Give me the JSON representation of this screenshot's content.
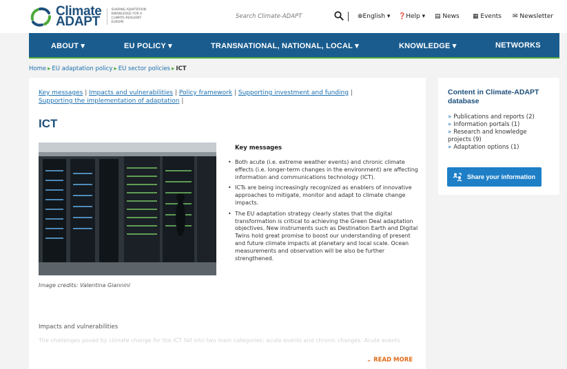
{
  "header": {
    "logo_line1": "Climate",
    "logo_line2": "ADAPT",
    "tagline": "Sharing adaptation knowledge for a climate-resilient Europe",
    "search_placeholder": "Search Climate-ADAPT",
    "language": "English",
    "help": "Help",
    "news": "News",
    "events": "Events",
    "newsletter": "Newsletter"
  },
  "nav": {
    "items": [
      "ABOUT",
      "EU POLICY",
      "TRANSNATIONAL, NATIONAL, LOCAL",
      "KNOWLEDGE",
      "NETWORKS"
    ]
  },
  "breadcrumb": {
    "home": "Home",
    "level1": "EU adaptation policy",
    "level2": "EU sector policies",
    "current": "ICT"
  },
  "toc": {
    "links": [
      "Key messages",
      "Impacts and vulnerabilities",
      "Policy framework",
      "Supporting investment and funding",
      "Supporting the implementation of adaptation"
    ],
    "sep": "|"
  },
  "page": {
    "title": "ICT",
    "image_caption": "Image credits: Valentina Giannini",
    "key_messages_title": "Key messages",
    "key_messages": [
      "Both acute (i.e. extreme weather events) and chronic climate effects (i.e. longer-term changes in the environment) are affecting information and communications technology (ICT).",
      "ICTs are being increasingly recognized as enablers of innovative approaches to mitigate, monitor and adapt to climate change impacts.",
      "The EU adaptation strategy clearly states that the digital transformation is critical to achieving the Green Deal adaptation objectives. New instruments such as Destination Earth and Digital Twins hold great promise to boost our understanding of present and future climate impacts at planetary and local scale. Ocean measurements and observation will be also be further strengthened."
    ],
    "impacts_title": "Impacts and vulnerabilities",
    "impacts_text": "The challenges posed by climate change for the ICT fall into two main categories: acute events and chronic changes. Acute events",
    "read_more": "READ MORE"
  },
  "sidebar": {
    "title": "Content in Climate-ADAPT database",
    "items": [
      "Publications and reports (2)",
      "Information portals (1)",
      "Research and knowledge projects (9)",
      "Adaptation options (1)"
    ],
    "share_button": "Share your information"
  },
  "colors": {
    "brand_blue": "#1a5c8e",
    "accent_green": "#4ea93a",
    "link_blue": "#1a6fb0",
    "read_more_orange": "#e06c1a",
    "button_blue": "#1e7fc7"
  }
}
